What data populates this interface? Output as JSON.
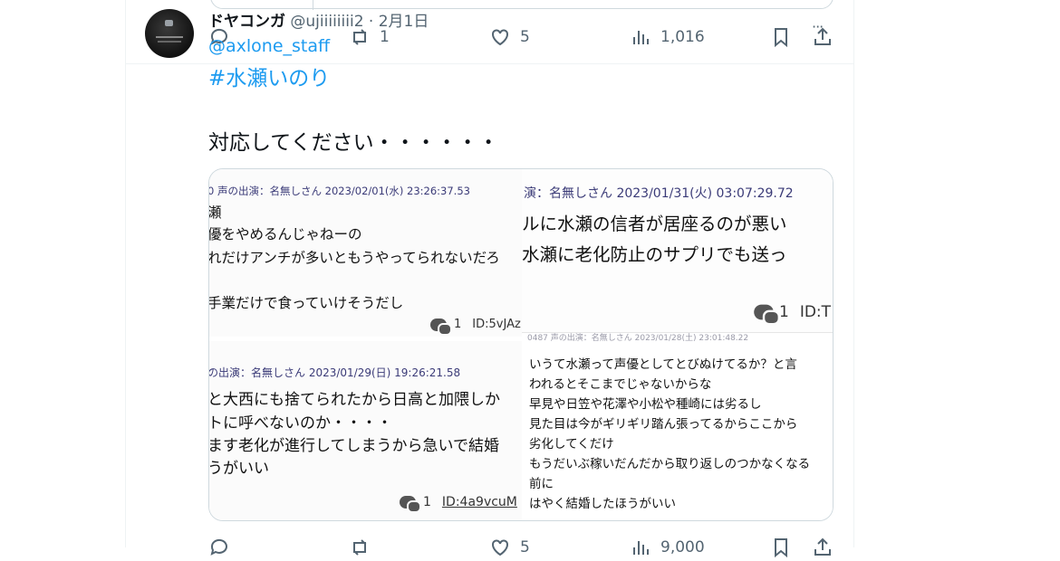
{
  "tweet": {
    "display_name": "ドヤコンガ",
    "handle": "@ujiiiiiiii2",
    "separator": "·",
    "date": "2月1日",
    "more": "···",
    "mention": "@axlone_staff",
    "hashtag": "#水瀬いのり",
    "text": "対応してください・・・・・・"
  },
  "actions": {
    "reply_count": "",
    "retweet_count": "1",
    "like_count": "5",
    "view_count": "1,016"
  },
  "bottom_actions": {
    "like_count": "5",
    "view_count": "9,000"
  },
  "media": {
    "shot1": {
      "meta": "0 声の出演：名無しさん 2023/02/01(水) 23:26:37.53",
      "lines": [
        "瀬",
        "優をやめるんじゃねーの",
        "れだけアンチが多いともうやってられないだろ",
        "",
        "手業だけで食っていけそうだし"
      ],
      "reply_count": "1",
      "id": "ID:5vJAz"
    },
    "shot2": {
      "meta": "演：名無しさん 2023/01/31(火) 03:07:29.72",
      "lines": [
        "ルに水瀬の信者が居座るのが悪い",
        "水瀬に老化防止のサプリでも送っ"
      ],
      "reply_count": "1",
      "id": "ID:T"
    },
    "shot3": {
      "meta": "の出演：名無しさん 2023/01/29(日) 19:26:21.58",
      "lines": [
        "と大西にも捨てられたから日高と加隈しか",
        "トに呼べないのか・・・・",
        "ます老化が進行してしまうから急いで結婚",
        "うがいい"
      ],
      "reply_count": "1",
      "id": "ID:4a9vcuM"
    },
    "shot4": {
      "meta": "0487 声の出演：名無しさん 2023/01/28(土) 23:01:48.22",
      "lines": [
        "いうて水瀬って声優としてとびぬけてるか？と言",
        "われるとそこまでじゃないからな",
        "早見や日笠や花澤や小松や種崎には劣るし",
        "見た目は今がギリギリ踏ん張ってるからここから",
        "劣化してくだけ",
        "もうだいぶ稼いだんだから取り返しのつかなくなる",
        "前に",
        "はやく結婚したほうがいい"
      ]
    }
  },
  "colors": {
    "link": "#1d9bf0",
    "secondary": "#536471",
    "meta": "#3b3b78"
  }
}
